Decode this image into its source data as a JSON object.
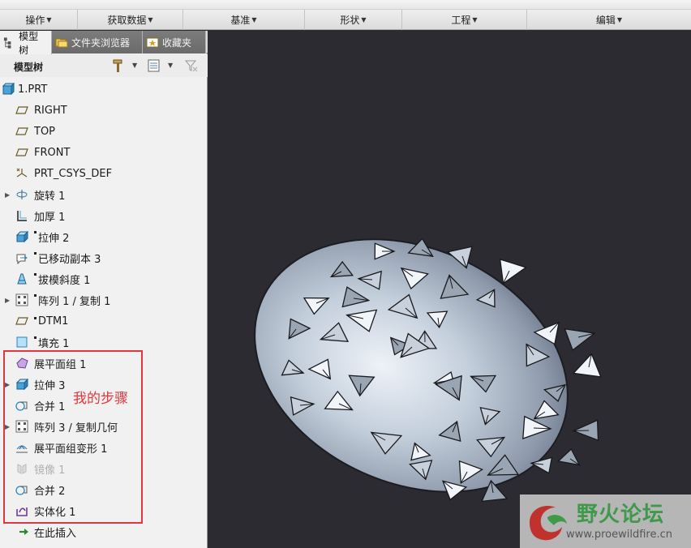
{
  "ribbon": {
    "groups": [
      {
        "label": "操作"
      },
      {
        "label": "获取数据"
      },
      {
        "label": "基准"
      },
      {
        "label": "形状"
      },
      {
        "label": "工程"
      },
      {
        "label": "编辑"
      }
    ]
  },
  "panel": {
    "tabs": [
      {
        "label": "模型树"
      },
      {
        "label": "文件夹浏览器"
      },
      {
        "label": "收藏夹"
      }
    ],
    "tree_title": "模型树"
  },
  "tree": {
    "items": [
      {
        "label": "1.PRT",
        "icon": "part-icon"
      },
      {
        "label": "RIGHT",
        "icon": "datum-plane-icon"
      },
      {
        "label": "TOP",
        "icon": "datum-plane-icon"
      },
      {
        "label": "FRONT",
        "icon": "datum-plane-icon"
      },
      {
        "label": "PRT_CSYS_DEF",
        "icon": "csys-icon"
      },
      {
        "label": "旋转 1",
        "icon": "revolve-icon"
      },
      {
        "label": "加厚 1",
        "icon": "thicken-icon"
      },
      {
        "label": "拉伸 2",
        "icon": "extrude-icon"
      },
      {
        "label": "已移动副本 3",
        "icon": "moved-copy-icon"
      },
      {
        "label": "拔模斜度 1",
        "icon": "draft-icon"
      },
      {
        "label": "阵列 1 / 复制 1",
        "icon": "pattern-icon"
      },
      {
        "label": "DTM1",
        "icon": "datum-plane-icon"
      },
      {
        "label": "填充 1",
        "icon": "fill-icon"
      },
      {
        "label": "展平面组 1",
        "icon": "flatten-quilt-icon"
      },
      {
        "label": "拉伸 3",
        "icon": "extrude-icon"
      },
      {
        "label": "合并 1",
        "icon": "merge-icon"
      },
      {
        "label": "阵列 3 / 复制几何",
        "icon": "pattern-icon"
      },
      {
        "label": "展平面组变形 1",
        "icon": "flatten-deform-icon"
      },
      {
        "label": "镜像 1",
        "icon": "mirror-icon"
      },
      {
        "label": "合并 2",
        "icon": "merge-icon"
      },
      {
        "label": "实体化 1",
        "icon": "solidify-icon"
      },
      {
        "label": "在此插入",
        "icon": "insert-here-icon"
      }
    ],
    "annotation": "我的步骤"
  },
  "watermark": {
    "title": "野火论坛",
    "url": "www.proewildfire.cn"
  },
  "colors": {
    "annotation_red": "#e0383e",
    "viewport_bg": "#2b2b31",
    "watermark_green": "#3e9a49"
  }
}
